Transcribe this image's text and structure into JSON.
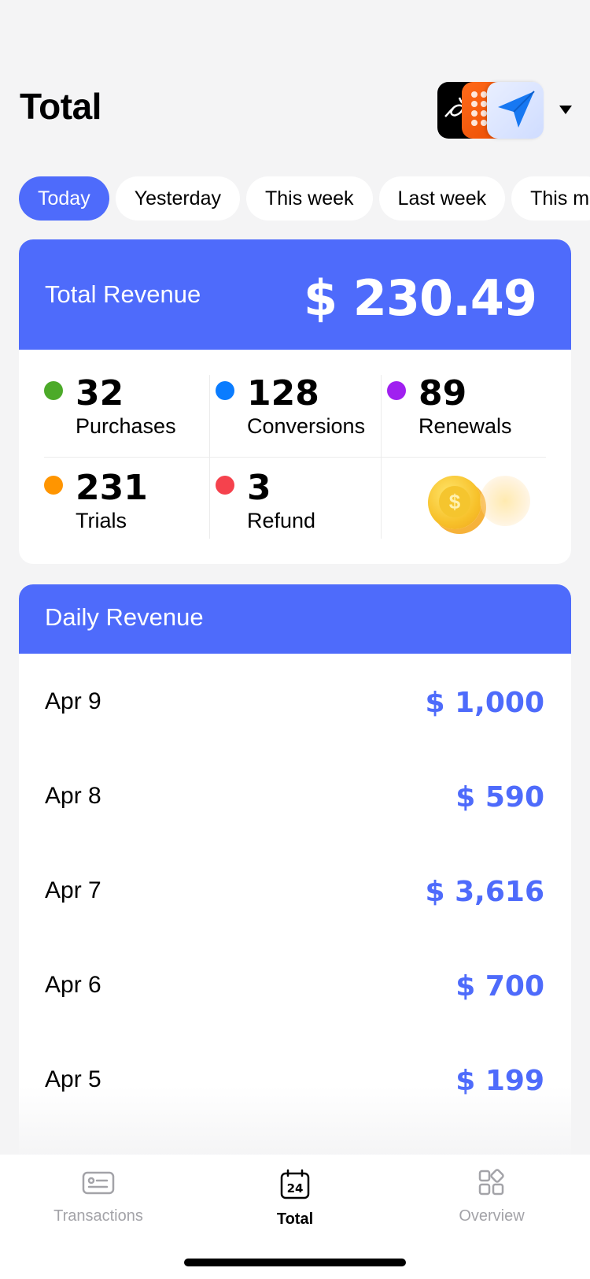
{
  "header": {
    "title": "Total"
  },
  "filters": [
    "Today",
    "Yesterday",
    "This week",
    "Last week",
    "This m"
  ],
  "revenue": {
    "label": "Total Revenue",
    "value": "$ 230.49",
    "stats": {
      "purchases": {
        "value": "32",
        "label": "Purchases",
        "color": "#4caa29"
      },
      "conversions": {
        "value": "128",
        "label": "Conversions",
        "color": "#0a7cff"
      },
      "renewals": {
        "value": "89",
        "label": "Renewals",
        "color": "#a020f0"
      },
      "trials": {
        "value": "231",
        "label": "Trials",
        "color": "#ff9500"
      },
      "refund": {
        "value": "3",
        "label": "Refund",
        "color": "#f5424d"
      }
    }
  },
  "daily": {
    "label": "Daily Revenue",
    "rows": [
      {
        "date": "Apr 9",
        "amount": "$ 1,000"
      },
      {
        "date": "Apr 8",
        "amount": "$ 590"
      },
      {
        "date": "Apr 7",
        "amount": "$ 3,616"
      },
      {
        "date": "Apr 6",
        "amount": "$ 700"
      },
      {
        "date": "Apr 5",
        "amount": "$ 199"
      }
    ]
  },
  "tabs": [
    {
      "label": "Transactions",
      "icon": "card-icon"
    },
    {
      "label": "Total",
      "icon": "calendar-24-icon"
    },
    {
      "label": "Overview",
      "icon": "grid-icon"
    }
  ],
  "colors": {
    "accent": "#4e6bfb",
    "background": "#f4f4f5"
  }
}
